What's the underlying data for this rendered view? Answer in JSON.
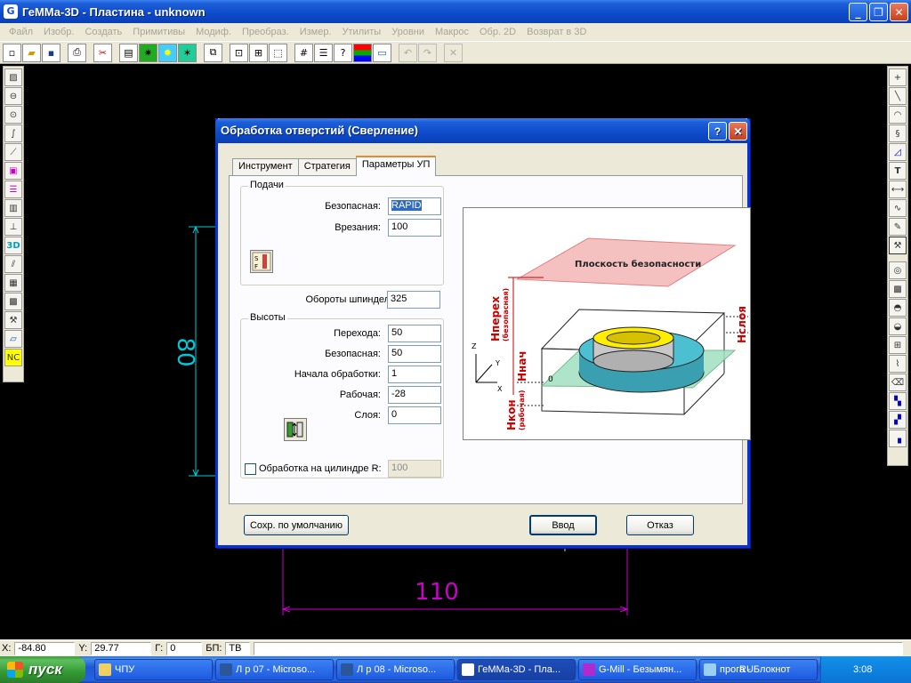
{
  "app": {
    "title": "ГеММа-3D - Пластина - unknown"
  },
  "menu": [
    "Файл",
    "Изобр.",
    "Создать",
    "Примитивы",
    "Модиф.",
    "Преобраз.",
    "Измер.",
    "Утилиты",
    "Уровни",
    "Макрос",
    "Обр. 2D",
    "Возврат в 3D"
  ],
  "canvas": {
    "dim_vertical": "80",
    "dim_horizontal": "110"
  },
  "dialog": {
    "title": "Обработка отверстий (Сверление)",
    "tabs": [
      "Инструмент",
      "Стратегия",
      "Параметры УП"
    ],
    "feeds": {
      "label": "Подачи",
      "safe_label": "Безопасная:",
      "safe_value": "RAPID",
      "plunge_label": "Врезания:",
      "plunge_value": "100"
    },
    "spindle": {
      "label": "Обороты шпинделя",
      "value": "325"
    },
    "heights": {
      "label": "Высоты",
      "transition_label": "Перехода:",
      "transition_value": "50",
      "safe_label": "Безопасная:",
      "safe_value": "50",
      "start_label": "Начала обработки:",
      "start_value": "1",
      "working_label": "Рабочая:",
      "working_value": "-28",
      "layer_label": "Слоя:",
      "layer_value": "0"
    },
    "cylinder": {
      "label": "Обработка на цилиндре R:",
      "value": "100",
      "checked": false
    },
    "picture": {
      "plane_label": "Плоскость безопасности",
      "h_trans_main": "Hперех",
      "h_trans_sub": "(безопасная)",
      "h_start": "Hнач",
      "h_end_main": "Hкон",
      "h_end_sub": "(рабочая)",
      "h_layer": "Hслоя",
      "axis_z": "Z",
      "axis_y": "Y",
      "axis_x": "X",
      "zero": "0"
    },
    "buttons": {
      "save_default": "Сохр. по умолчанию",
      "ok": "Ввод",
      "cancel": "Отказ"
    }
  },
  "statusbar": {
    "x_label": "X:",
    "x_value": "-84.80",
    "y_label": "Y:",
    "y_value": "29.77",
    "g_label": "Г:",
    "g_value": "0",
    "bp_label": "БП:",
    "bp_value": "ТВ"
  },
  "taskbar": {
    "start": "пуск",
    "tasks": [
      "ЧПУ",
      "Л р 07 - Microso...",
      "Л р 08 - Microso...",
      "ГеММа-3D - Пла...",
      "G-Mill - Безымян...",
      "прога - Блокнот"
    ],
    "lang": "RU",
    "time": "3:08"
  },
  "colors": {
    "accent": "#0a3fb5",
    "cyan_dim": "#00c8d8",
    "magenta_dim": "#cc00cc",
    "red_label": "#cc0000"
  }
}
